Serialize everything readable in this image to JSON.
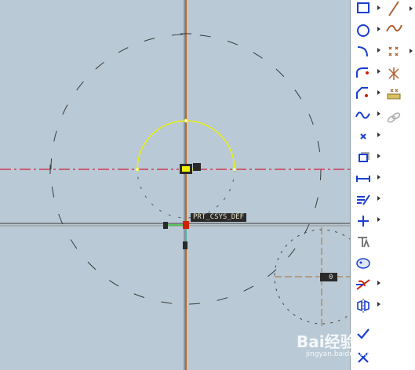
{
  "canvas": {
    "labels": {
      "csys": "PRT_CSYS_DEF",
      "dim_left": "",
      "dim_right": "",
      "dim_lower": "0"
    }
  },
  "toolbar": {
    "tools": [
      {
        "name": "rectangle-tool",
        "icon": "rectangle-icon"
      },
      {
        "name": "circle-tool",
        "icon": "circle-icon"
      },
      {
        "name": "arc-tool",
        "icon": "arc-icon"
      },
      {
        "name": "fillet-tool",
        "icon": "fillet-icon"
      },
      {
        "name": "chamfer-tool",
        "icon": "chamfer-icon"
      },
      {
        "name": "spline-tool",
        "icon": "spline-icon"
      },
      {
        "name": "point-tool",
        "icon": "point-icon"
      },
      {
        "name": "offset-tool",
        "icon": "offset-icon"
      },
      {
        "name": "dimension-tool",
        "icon": "dimension-icon"
      },
      {
        "name": "modify-tool",
        "icon": "modify-icon"
      },
      {
        "name": "constraint-tool",
        "icon": "constraint-icon"
      },
      {
        "name": "text-tool",
        "icon": "text-icon"
      },
      {
        "name": "palette-tool",
        "icon": "palette-icon"
      },
      {
        "name": "trim-tool",
        "icon": "trim-icon"
      },
      {
        "name": "mirror-tool",
        "icon": "mirror-icon"
      },
      {
        "name": "done-tool",
        "icon": "check-icon"
      },
      {
        "name": "cancel-tool",
        "icon": "close-icon"
      }
    ],
    "side_tools": [
      {
        "name": "line-tool",
        "icon": "line-icon"
      },
      {
        "name": "curve-tool",
        "icon": "curve-icon"
      },
      {
        "name": "point-array-tool",
        "icon": "point-array-icon"
      },
      {
        "name": "coordinate-system-tool",
        "icon": "csys-icon"
      },
      {
        "name": "measure-tool",
        "icon": "measure-icon"
      },
      {
        "name": "chain-tool",
        "icon": "chain-icon"
      }
    ]
  },
  "watermark": {
    "logo": "Bai经验",
    "url": "jingyan.baidu.com"
  },
  "colors": {
    "canvas_bg": "#b9cad6",
    "axis_orange": "#c8641e",
    "centerline_red": "#d0203c",
    "sketch_yellow": "#f0f000",
    "construction_dark": "#3a3a3a",
    "accent_red": "#cc2200",
    "accent_blue": "#1a3fcf"
  }
}
